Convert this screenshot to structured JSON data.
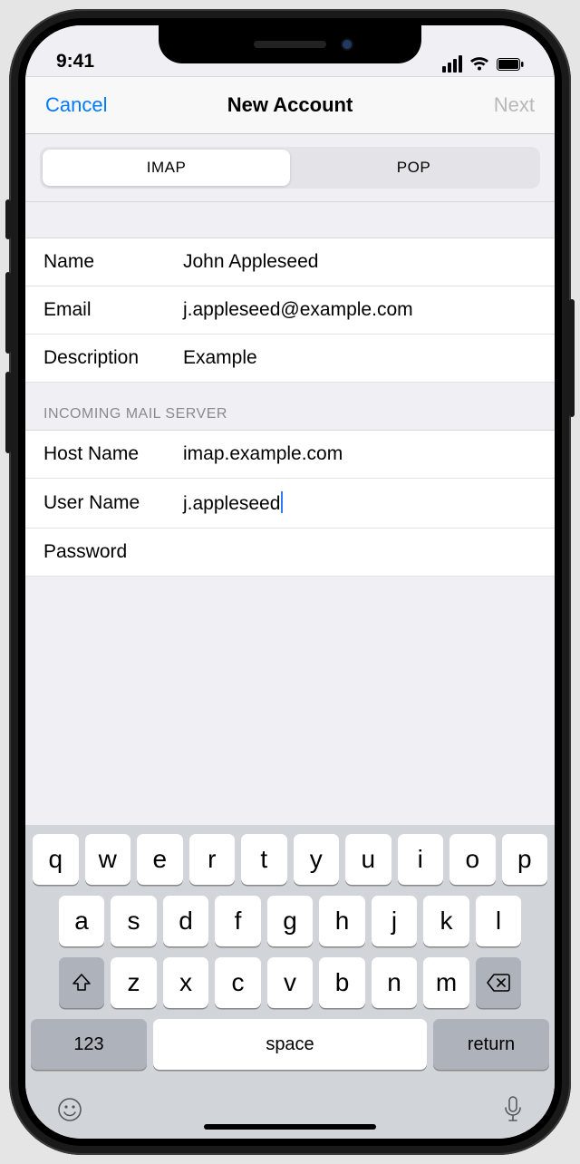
{
  "status": {
    "time": "9:41"
  },
  "nav": {
    "cancel": "Cancel",
    "title": "New Account",
    "next": "Next"
  },
  "segments": {
    "imap": "IMAP",
    "pop": "POP"
  },
  "account": {
    "name_label": "Name",
    "name_value": "John Appleseed",
    "email_label": "Email",
    "email_value": "j.appleseed@example.com",
    "desc_label": "Description",
    "desc_value": "Example"
  },
  "incoming": {
    "header": "INCOMING MAIL SERVER",
    "host_label": "Host Name",
    "host_value": "imap.example.com",
    "user_label": "User Name",
    "user_value": "j.appleseed",
    "pass_label": "Password",
    "pass_value": ""
  },
  "keyboard": {
    "row1": [
      "q",
      "w",
      "e",
      "r",
      "t",
      "y",
      "u",
      "i",
      "o",
      "p"
    ],
    "row2": [
      "a",
      "s",
      "d",
      "f",
      "g",
      "h",
      "j",
      "k",
      "l"
    ],
    "row3": [
      "z",
      "x",
      "c",
      "v",
      "b",
      "n",
      "m"
    ],
    "numbers": "123",
    "space": "space",
    "return": "return"
  }
}
